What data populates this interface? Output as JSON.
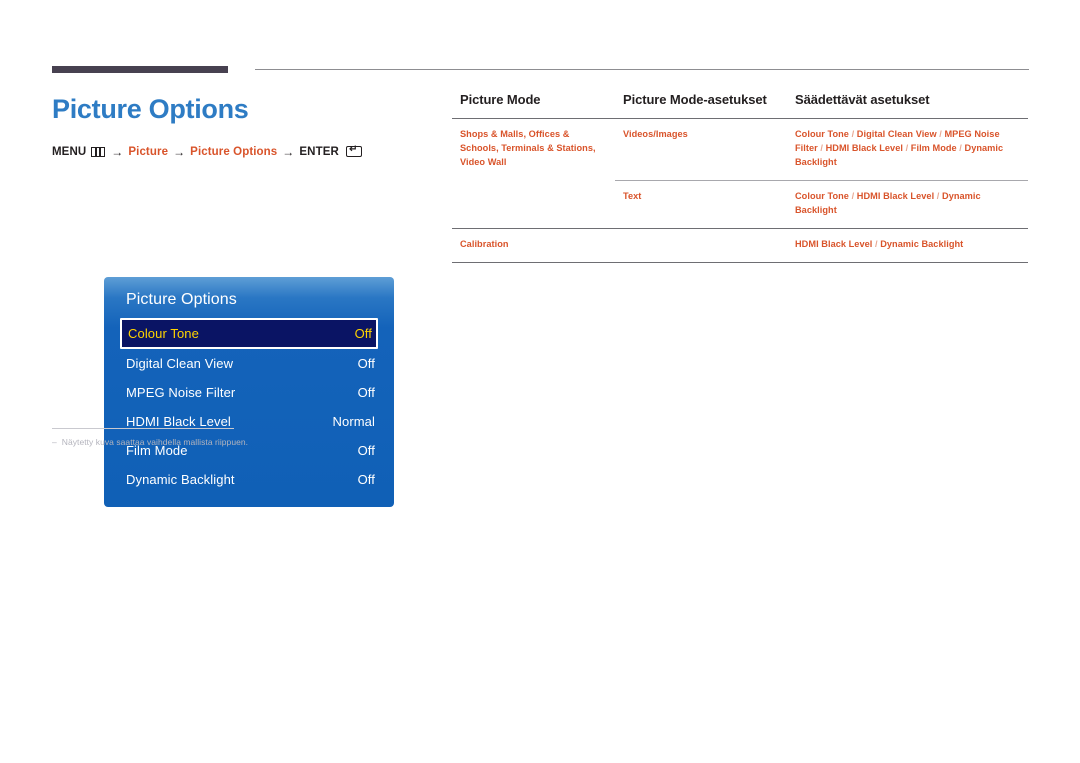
{
  "page": {
    "title": "Picture Options"
  },
  "breadcrumb": {
    "menu_label": "MENU",
    "menu_icon": "menu-grid-icon",
    "arrow": "→",
    "step1": "Picture",
    "step2": "Picture Options",
    "enter_label": "ENTER",
    "enter_icon": "enter-key-icon"
  },
  "osd": {
    "title": "Picture Options",
    "rows": [
      {
        "label": "Colour Tone",
        "value": "Off",
        "selected": true
      },
      {
        "label": "Digital Clean View",
        "value": "Off",
        "selected": false
      },
      {
        "label": "MPEG Noise Filter",
        "value": "Off",
        "selected": false
      },
      {
        "label": "HDMI Black Level",
        "value": "Normal",
        "selected": false
      },
      {
        "label": "Film Mode",
        "value": "Off",
        "selected": false
      },
      {
        "label": "Dynamic Backlight",
        "value": "Off",
        "selected": false
      }
    ]
  },
  "footnote": {
    "dash": "–",
    "text": "Näytetty kuva saattaa vaihdella mallista riippuen."
  },
  "table": {
    "headers": [
      "Picture Mode",
      "Picture Mode-asetukset",
      "Säädettävät asetukset"
    ],
    "rows": [
      {
        "picture_mode": "Shops & Malls, Offices & Schools, Terminals & Stations, Video Wall",
        "sub_rows": [
          {
            "mode_setting": "Videos/Images",
            "adjustable": "Colour Tone / Digital Clean View / MPEG Noise Filter / HDMI Black Level / Film Mode / Dynamic Backlight"
          },
          {
            "mode_setting": "Text",
            "adjustable": "Colour Tone / HDMI Black Level / Dynamic Backlight"
          }
        ]
      },
      {
        "picture_mode": "Calibration",
        "sub_rows": [
          {
            "mode_setting": "",
            "adjustable": "HDMI Black Level / Dynamic Backlight"
          }
        ]
      }
    ]
  },
  "colors": {
    "title_blue": "#2e7cc4",
    "accent_orange": "#d9542b",
    "osd_blue": "#1463ba",
    "osd_selected_navy": "#0a1464",
    "osd_selected_text": "#ffd400",
    "rule_dark": "#474150"
  }
}
